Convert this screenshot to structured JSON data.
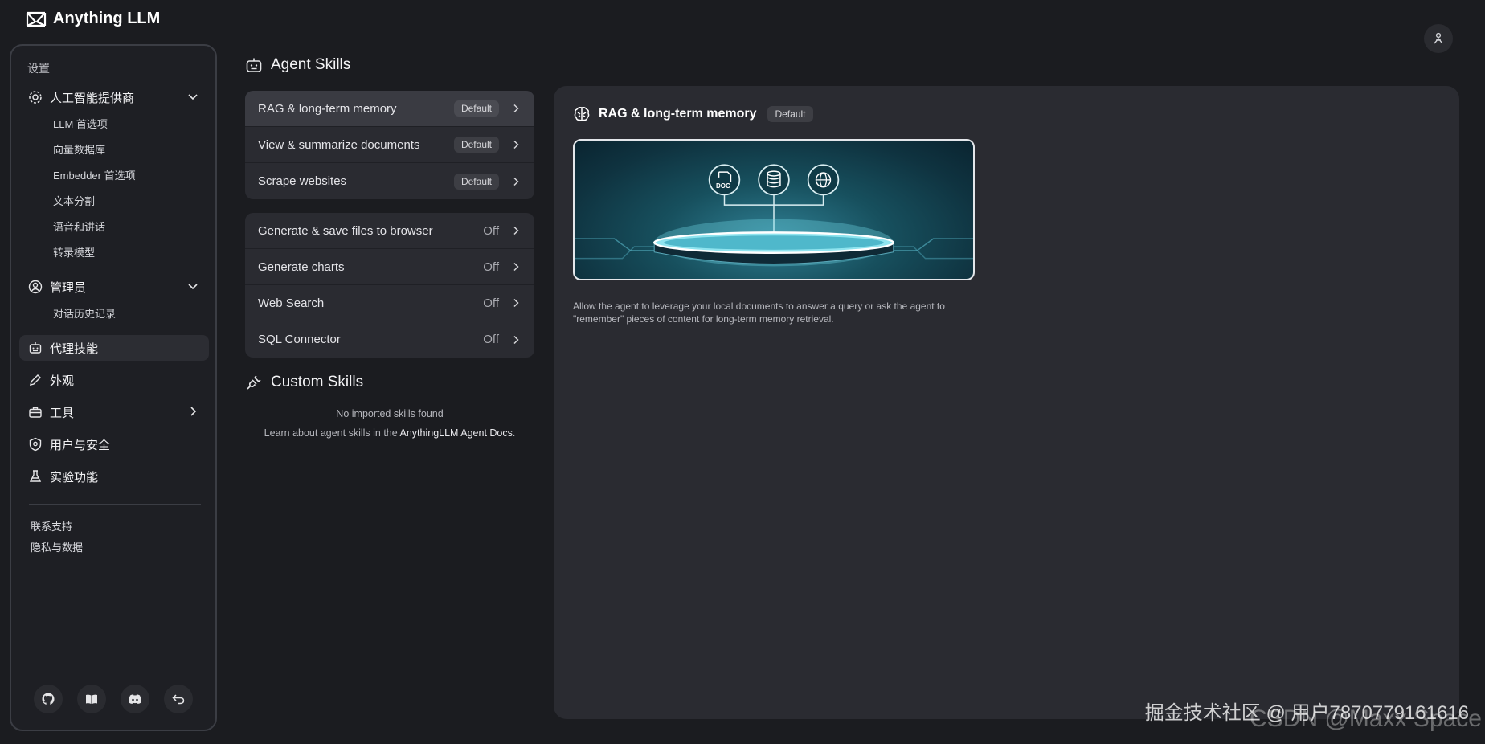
{
  "app": {
    "name": "Anything LLM"
  },
  "sidebar": {
    "section_title": "设置",
    "groups": [
      {
        "label": "人工智能提供商",
        "icon": "gear-icon",
        "expanded": true,
        "items": [
          "LLM 首选项",
          "向量数据库",
          "Embedder 首选项",
          "文本分割",
          "语音和讲话",
          "转录模型"
        ]
      },
      {
        "label": "管理员",
        "icon": "user-gear-icon",
        "expanded": true,
        "items": [
          "对话历史记录"
        ]
      }
    ],
    "items": [
      {
        "label": "代理技能",
        "icon": "robot-icon",
        "active": true
      },
      {
        "label": "外观",
        "icon": "pencil-icon"
      },
      {
        "label": "工具",
        "icon": "toolbox-icon",
        "has_children": true
      },
      {
        "label": "用户与安全",
        "icon": "shield-icon"
      },
      {
        "label": "实验功能",
        "icon": "flask-icon"
      }
    ],
    "footer_links": [
      "联系支持",
      "隐私与数据"
    ],
    "bottom_icons": [
      "github-icon",
      "book-icon",
      "discord-icon",
      "undo-icon"
    ]
  },
  "agent_skills": {
    "title": "Agent Skills",
    "default_skills": [
      {
        "label": "RAG & long-term memory",
        "status": "Default",
        "selected": true
      },
      {
        "label": "View & summarize documents",
        "status": "Default"
      },
      {
        "label": "Scrape websites",
        "status": "Default"
      }
    ],
    "optional_skills": [
      {
        "label": "Generate & save files to browser",
        "status": "Off"
      },
      {
        "label": "Generate charts",
        "status": "Off"
      },
      {
        "label": "Web Search",
        "status": "Off"
      },
      {
        "label": "SQL Connector",
        "status": "Off"
      }
    ]
  },
  "custom_skills": {
    "title": "Custom Skills",
    "empty_text": "No imported skills found",
    "learn_prefix": "Learn about agent skills in the ",
    "learn_link": "AnythingLLM Agent Docs",
    "learn_suffix": "."
  },
  "detail": {
    "title": "RAG & long-term memory",
    "badge": "Default",
    "description": "Allow the agent to leverage your local documents to answer a query or ask the agent to \"remember\" pieces of content for long-term memory retrieval.",
    "hero_icon_doc_label": "DOC"
  },
  "watermark": {
    "line1": "掘金技术社区 @ 用户7870779161616",
    "line2": "CSDN @Maxx Space"
  },
  "colors": {
    "background": "#1b1c20",
    "panel": "#2a2b31",
    "selected_row": "#3a3b42",
    "accent_hero": "#2f7f93"
  }
}
